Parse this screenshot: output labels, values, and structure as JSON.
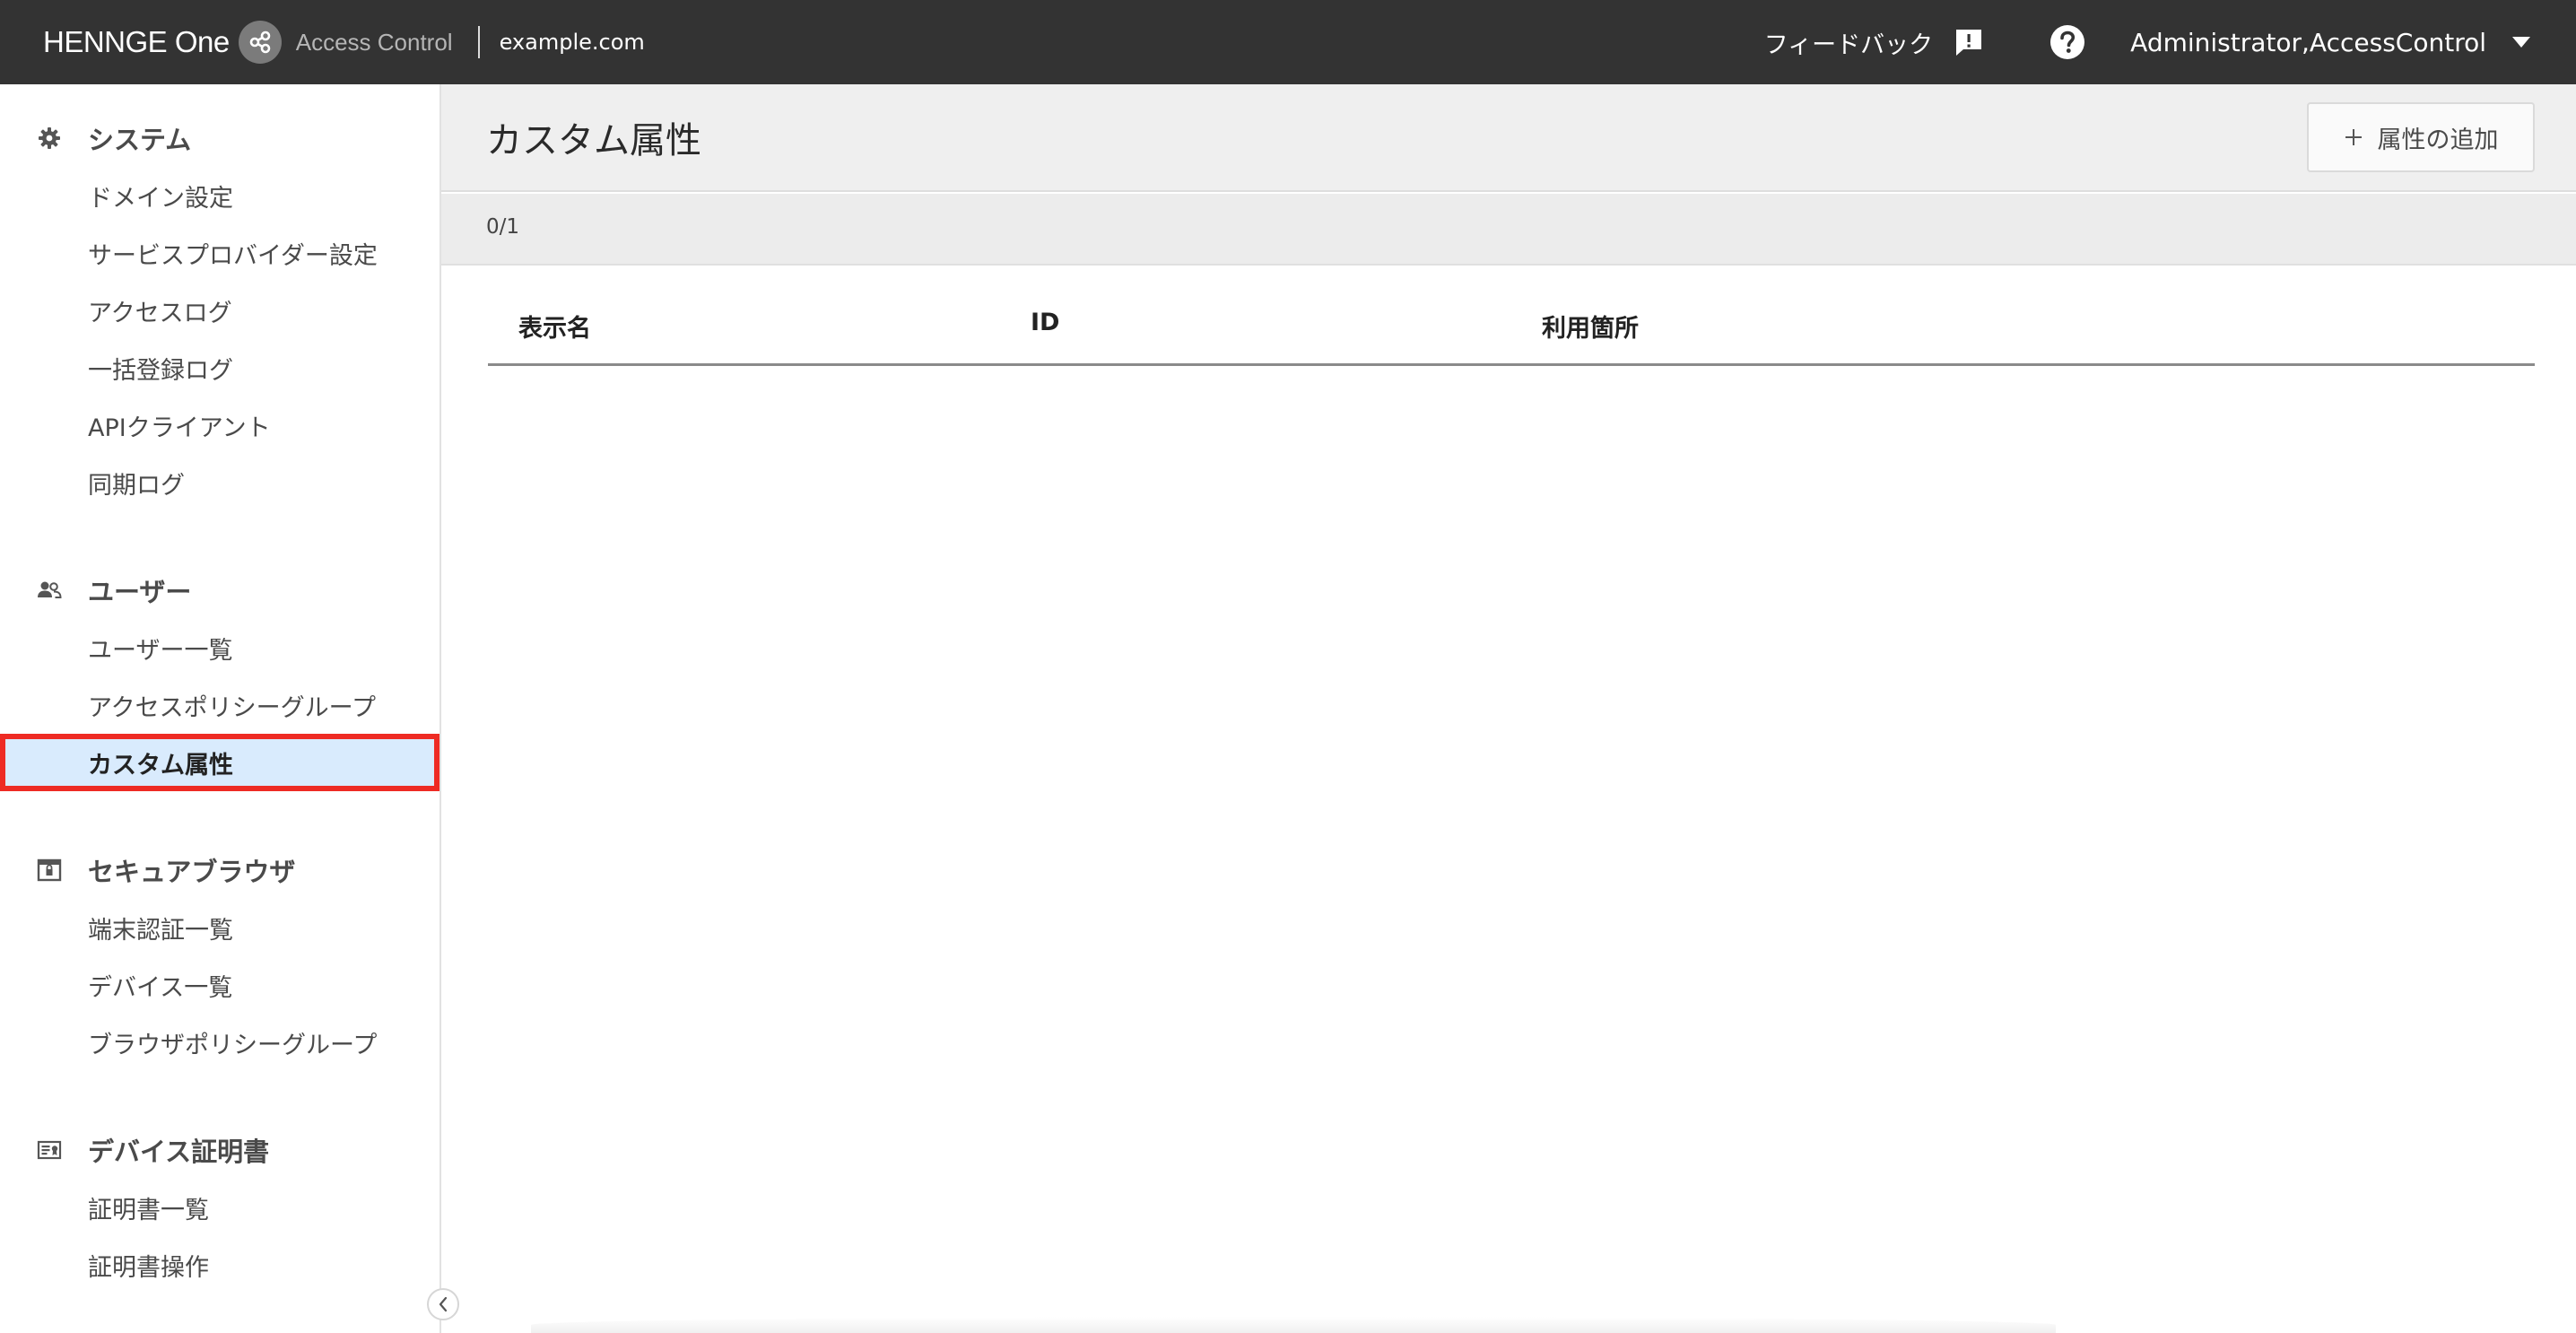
{
  "header": {
    "brand_name": "HENNGE One",
    "product_name": "Access Control",
    "domain": "example.com",
    "feedback_label": "フィードバック",
    "account_label": "Administrator,AccessControl"
  },
  "sidebar": {
    "sections": [
      {
        "title": "システム",
        "icon": "gear-icon",
        "items": [
          "ドメイン設定",
          "サービスプロバイダー設定",
          "アクセスログ",
          "一括登録ログ",
          "APIクライアント",
          "同期ログ"
        ]
      },
      {
        "title": "ユーザー",
        "icon": "users-icon",
        "items": [
          "ユーザー一覧",
          "アクセスポリシーグループ",
          "カスタム属性"
        ]
      },
      {
        "title": "セキュアブラウザ",
        "icon": "browser-icon",
        "items": [
          "端末認証一覧",
          "デバイス一覧",
          "ブラウザポリシーグループ"
        ]
      },
      {
        "title": "デバイス証明書",
        "icon": "certificate-icon",
        "items": [
          "証明書一覧",
          "証明書操作"
        ]
      }
    ],
    "active_item": "カスタム属性"
  },
  "main": {
    "page_title": "カスタム属性",
    "add_button_label": "属性の追加",
    "count": "0/1",
    "table": {
      "columns": [
        "表示名",
        "ID",
        "利用箇所"
      ],
      "rows": []
    }
  },
  "colors": {
    "topbar": "#333333",
    "active_item_bg": "#d9ebfd",
    "highlight_border": "#ee2b24"
  }
}
